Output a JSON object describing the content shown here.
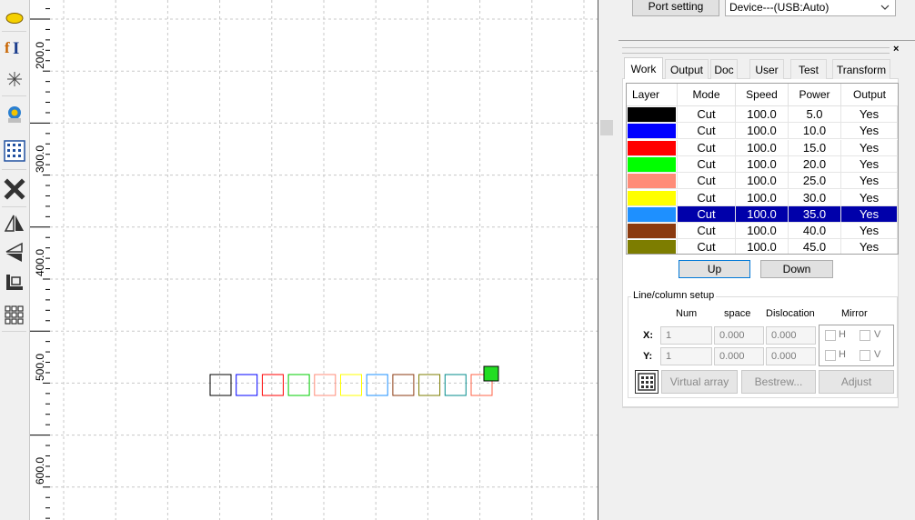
{
  "ruler": {
    "labels": [
      "200.0",
      "300.0",
      "400.0",
      "500.0",
      "600.0"
    ]
  },
  "top": {
    "port_setting_label": "Port setting",
    "device_value": "Device---(USB:Auto)"
  },
  "tabs": [
    "Work",
    "Output",
    "Doc",
    "User",
    "Test",
    "Transform"
  ],
  "active_tab": "Work",
  "layer_table": {
    "headers": [
      "Layer",
      "Mode",
      "Speed",
      "Power",
      "Output"
    ],
    "rows": [
      {
        "color": "#000000",
        "mode": "Cut",
        "speed": "100.0",
        "power": "5.0",
        "output": "Yes"
      },
      {
        "color": "#0000ff",
        "mode": "Cut",
        "speed": "100.0",
        "power": "10.0",
        "output": "Yes"
      },
      {
        "color": "#ff0000",
        "mode": "Cut",
        "speed": "100.0",
        "power": "15.0",
        "output": "Yes"
      },
      {
        "color": "#00ff00",
        "mode": "Cut",
        "speed": "100.0",
        "power": "20.0",
        "output": "Yes"
      },
      {
        "color": "#ff8c78",
        "mode": "Cut",
        "speed": "100.0",
        "power": "25.0",
        "output": "Yes"
      },
      {
        "color": "#ffff00",
        "mode": "Cut",
        "speed": "100.0",
        "power": "30.0",
        "output": "Yes"
      },
      {
        "color": "#1e90ff",
        "mode": "Cut",
        "speed": "100.0",
        "power": "35.0",
        "output": "Yes",
        "selected": true
      },
      {
        "color": "#8b3a0f",
        "mode": "Cut",
        "speed": "100.0",
        "power": "40.0",
        "output": "Yes"
      },
      {
        "color": "#7d7d00",
        "mode": "Cut",
        "speed": "100.0",
        "power": "45.0",
        "output": "Yes"
      }
    ]
  },
  "buttons": {
    "up": "Up",
    "down": "Down"
  },
  "line_column": {
    "title": "Line/column setup",
    "col_headers": [
      "Num",
      "space",
      "Dislocation",
      "Mirror"
    ],
    "x_label": "X:",
    "y_label": "Y:",
    "x_num": "1",
    "x_space": "0.000",
    "x_dislocation": "0.000",
    "y_num": "1",
    "y_space": "0.000",
    "y_dislocation": "0.000",
    "mirror_h": "H",
    "mirror_v": "V",
    "virtual_array": "Virtual array",
    "bestrew": "Bestrew...",
    "adjust": "Adjust"
  },
  "canvas_shapes": [
    {
      "color": "#000000"
    },
    {
      "color": "#0000ff"
    },
    {
      "color": "#ff0000"
    },
    {
      "color": "#00cc00"
    },
    {
      "color": "#ff8c78"
    },
    {
      "color": "#ffff00"
    },
    {
      "color": "#1e90ff"
    },
    {
      "color": "#8b3a0f"
    },
    {
      "color": "#7d7d00"
    },
    {
      "color": "#008b8b"
    },
    {
      "color": "#ff6347"
    }
  ],
  "icons": [
    "ellipse-tool-icon",
    "text-tool-icon",
    "dot-tool-icon",
    "laser-head-icon",
    "grid-array-icon",
    "delete-icon",
    "mirror-horizontal-icon",
    "mirror-vertical-icon",
    "align-icon",
    "array-icon"
  ]
}
